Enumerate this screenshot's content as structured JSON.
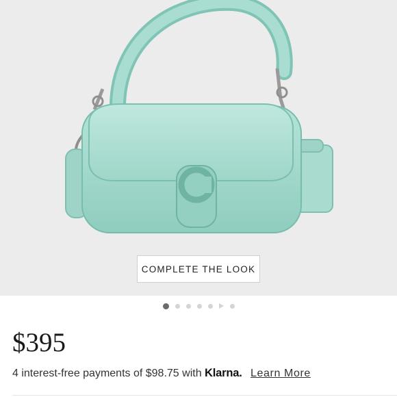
{
  "product": {
    "image_alt": "Mint handbag with C clasp",
    "cta_label": "COMPLETE THE LOOK",
    "carousel": {
      "total_slides": 7,
      "active_index": 0
    },
    "price": "$395",
    "installments": {
      "text": "4 interest-free payments of $98.75 with",
      "provider": "Klarna.",
      "link": "Learn More"
    }
  },
  "colors": {
    "bag": "#a8dcd0",
    "background": "#ececec"
  }
}
